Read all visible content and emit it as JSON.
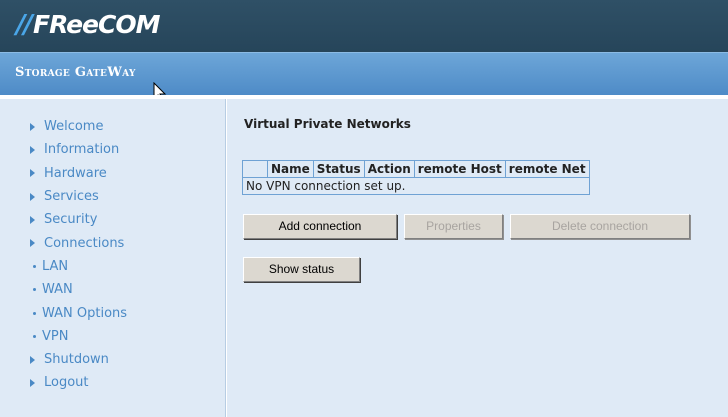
{
  "brand": {
    "logo_slashes": "//",
    "logo_text": "FReeCOM",
    "product": "Storage GateWay"
  },
  "sidebar": {
    "items": [
      {
        "label": "Welcome",
        "type": "section"
      },
      {
        "label": "Information",
        "type": "section"
      },
      {
        "label": "Hardware",
        "type": "section"
      },
      {
        "label": "Services",
        "type": "section"
      },
      {
        "label": "Security",
        "type": "section"
      },
      {
        "label": "Connections",
        "type": "section"
      },
      {
        "label": "LAN",
        "type": "sub"
      },
      {
        "label": "WAN",
        "type": "sub"
      },
      {
        "label": "WAN Options",
        "type": "sub"
      },
      {
        "label": "VPN",
        "type": "sub"
      },
      {
        "label": "Shutdown",
        "type": "section"
      },
      {
        "label": "Logout",
        "type": "section"
      }
    ]
  },
  "main": {
    "title": "Virtual Private Networks",
    "table": {
      "headers": [
        "",
        "Name",
        "Status",
        "Action",
        "remote Host",
        "remote Net"
      ],
      "empty_message": "No VPN connection set up."
    },
    "buttons": {
      "add": "Add connection",
      "properties": "Properties",
      "delete": "Delete connection",
      "show_status": "Show status"
    }
  },
  "colors": {
    "header_bg": "#2f5066",
    "subheader_bg": "#5a96cf",
    "panel_bg": "#dfeaf6",
    "link": "#4a89c5",
    "table_border": "#6fa2d4"
  }
}
